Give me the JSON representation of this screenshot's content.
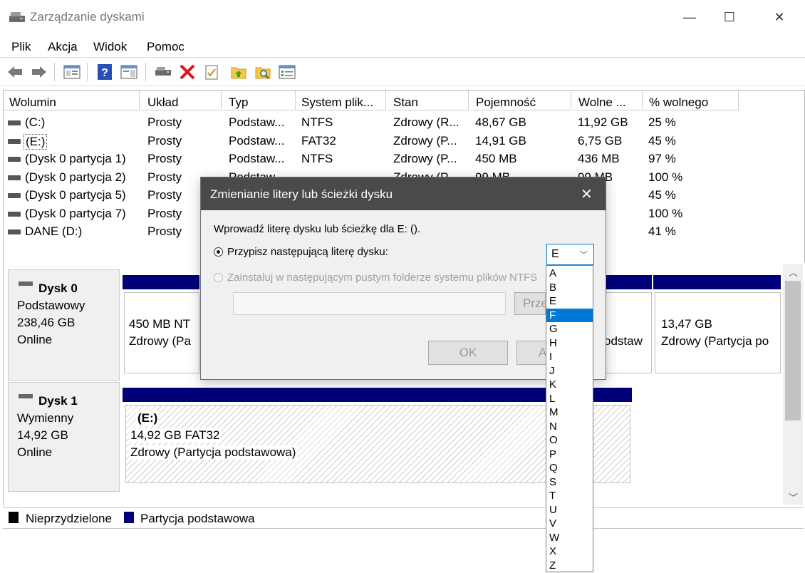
{
  "window": {
    "title": "Zarządzanie dyskami",
    "minimize": "—",
    "maximize": "☐",
    "close": "✕"
  },
  "menu": [
    "Plik",
    "Akcja",
    "Widok",
    "Pomoc"
  ],
  "volume_table": {
    "columns": [
      "Wolumin",
      "Układ",
      "Typ",
      "System plik...",
      "Stan",
      "Pojemność",
      "Wolne ...",
      "% wolnego"
    ],
    "rows": [
      [
        "(C:)",
        "Prosty",
        "Podstaw...",
        "NTFS",
        "Zdrowy (R...",
        "48,67 GB",
        "11,92 GB",
        "25 %"
      ],
      [
        "(E:)",
        "Prosty",
        "Podstaw...",
        "FAT32",
        "Zdrowy (P...",
        "14,91 GB",
        "6,75 GB",
        "45 %"
      ],
      [
        "(Dysk 0 partycja 1)",
        "Prosty",
        "Podstaw...",
        "NTFS",
        "Zdrowy (P...",
        "450 MB",
        "436 MB",
        "97 %"
      ],
      [
        "(Dysk 0 partycja 2)",
        "Prosty",
        "Podstaw...",
        "",
        "Zdrowy (P...",
        "99 MB",
        "99 MB",
        "100 %"
      ],
      [
        "(Dysk 0 partycja 5)",
        "Prosty",
        "",
        "",
        "",
        "",
        "MB",
        "45 %"
      ],
      [
        "(Dysk 0 partycja 7)",
        "Prosty",
        "",
        "",
        "",
        "",
        "7 GB",
        "100 %"
      ],
      [
        "DANE (D:)",
        "Prosty",
        "",
        "",
        "",
        "",
        "3 GB",
        "41 %"
      ]
    ]
  },
  "disks": [
    {
      "name": "Dysk 0",
      "type": "Podstawowy",
      "size": "238,46 GB",
      "status": "Online",
      "part1_size": "450 MB NT",
      "part1_status": "Zdrowy (Pa",
      "part_mid_status": "odstaw",
      "part_last_size": "13,47 GB",
      "part_last_status": "Zdrowy (Partycja po"
    },
    {
      "name": "Dysk 1",
      "type": "Wymienny",
      "size": "14,92 GB",
      "status": "Online",
      "part_label": "(E:)",
      "part_size": "14,92 GB FAT32",
      "part_status": "Zdrowy (Partycja podstawowa)"
    }
  ],
  "legend": {
    "unallocated": "Nieprzydzielone",
    "primary": "Partycja podstawowa"
  },
  "dialog": {
    "title": "Zmienianie litery lub ścieżki dysku",
    "prompt": "Wprowadź literę dysku lub ścieżkę dla E: ().",
    "option_assign": "Przypisz następującą literę dysku:",
    "option_mount": "Zainstaluj w następującym pustym folderze systemu plików NTFS",
    "browse": "Prze",
    "ok": "OK",
    "cancel": "A",
    "selected_letter": "E",
    "letters": [
      "A",
      "B",
      "E",
      "F",
      "G",
      "H",
      "I",
      "J",
      "K",
      "L",
      "M",
      "N",
      "O",
      "P",
      "Q",
      "S",
      "T",
      "U",
      "V",
      "W",
      "X",
      "Z"
    ],
    "highlighted": "F"
  }
}
